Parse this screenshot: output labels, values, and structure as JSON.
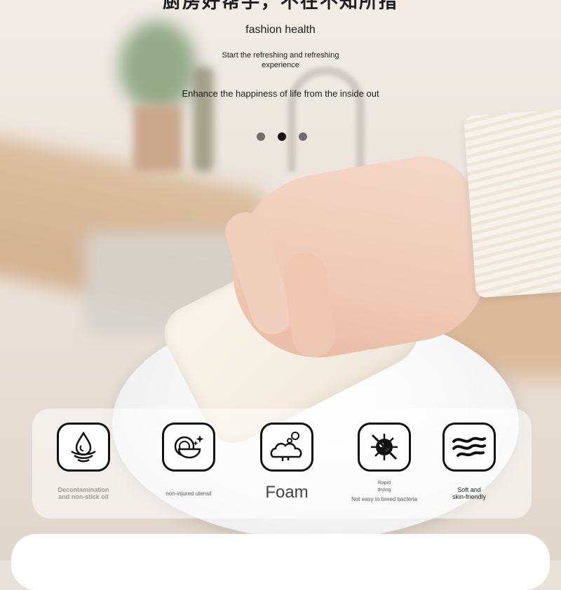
{
  "header": {
    "title_cn": "厨房好帮手，不在不知所措",
    "subtitle": "fashion health",
    "description_lines": [
      "Start the refreshing and refreshing",
      "experience"
    ],
    "tagline": "Enhance the happiness of life from the inside out"
  },
  "carousel": {
    "total": 3,
    "active_index": 1
  },
  "features": [
    {
      "icon": "water-drop-decontamination-icon",
      "label_lines": [
        "Decontamination",
        "and non-stick oil"
      ]
    },
    {
      "icon": "dishes-sparkle-icon",
      "label_lines": [
        "non-injured utensil"
      ]
    },
    {
      "icon": "foam-bubbles-icon",
      "label_lines": [
        "Foam"
      ]
    },
    {
      "icon": "no-bacteria-icon",
      "label_lines": [
        "Rapid",
        "drying",
        "Not easy to breed bacteria"
      ]
    },
    {
      "icon": "soft-waves-icon",
      "label_lines": [
        "Soft and",
        "skin-friendly"
      ]
    }
  ]
}
